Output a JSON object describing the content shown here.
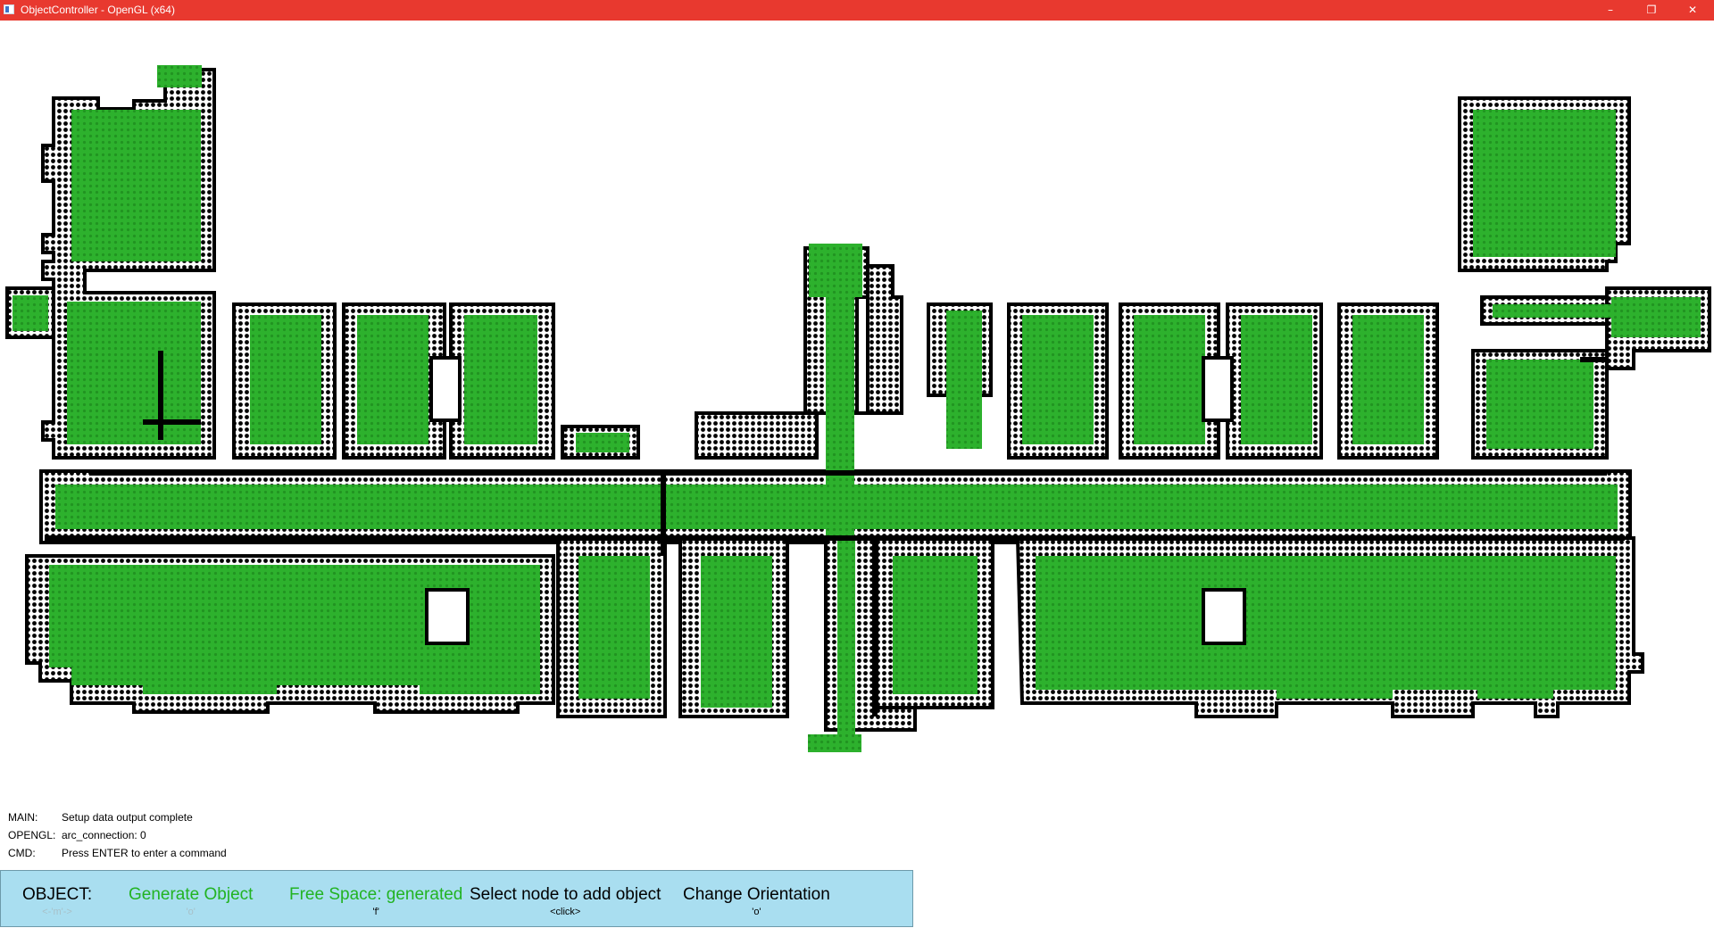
{
  "window": {
    "title": "ObjectController - OpenGL (x64)",
    "titlebar_color": "#e8392f",
    "icon": "app-window-icon",
    "controls": {
      "minimize": "–",
      "restore": "❐",
      "close": "✕"
    }
  },
  "map": {
    "description_icon": "floorplan-occupancy-grid",
    "colors": {
      "free_space": "#2db12d",
      "wall": "#000000",
      "background": "#ffffff"
    }
  },
  "console": {
    "lines": [
      {
        "key": "MAIN:",
        "value": "Setup data output complete"
      },
      {
        "key": "OPENGL:",
        "value": "arc_connection: 0"
      },
      {
        "key": "CMD:",
        "value": "Press ENTER to enter a command"
      }
    ]
  },
  "menu": {
    "background": "#a9def0",
    "items": [
      {
        "label": "OBJECT:",
        "key": "<-'m'->",
        "color": "#000000",
        "key_color": "#a8c0c8"
      },
      {
        "label": "Generate Object",
        "key": "'o'",
        "color": "#22b322",
        "key_color": "#a8c0c8"
      },
      {
        "label": "Free Space: generated",
        "key": "'f'",
        "color": "#22b322",
        "key_color": "#000000"
      },
      {
        "label": "Select node to add object",
        "key": "<click>",
        "color": "#000000",
        "key_color": "#000000"
      },
      {
        "label": "Change Orientation",
        "key": "'o'",
        "color": "#000000",
        "key_color": "#000000"
      }
    ]
  }
}
